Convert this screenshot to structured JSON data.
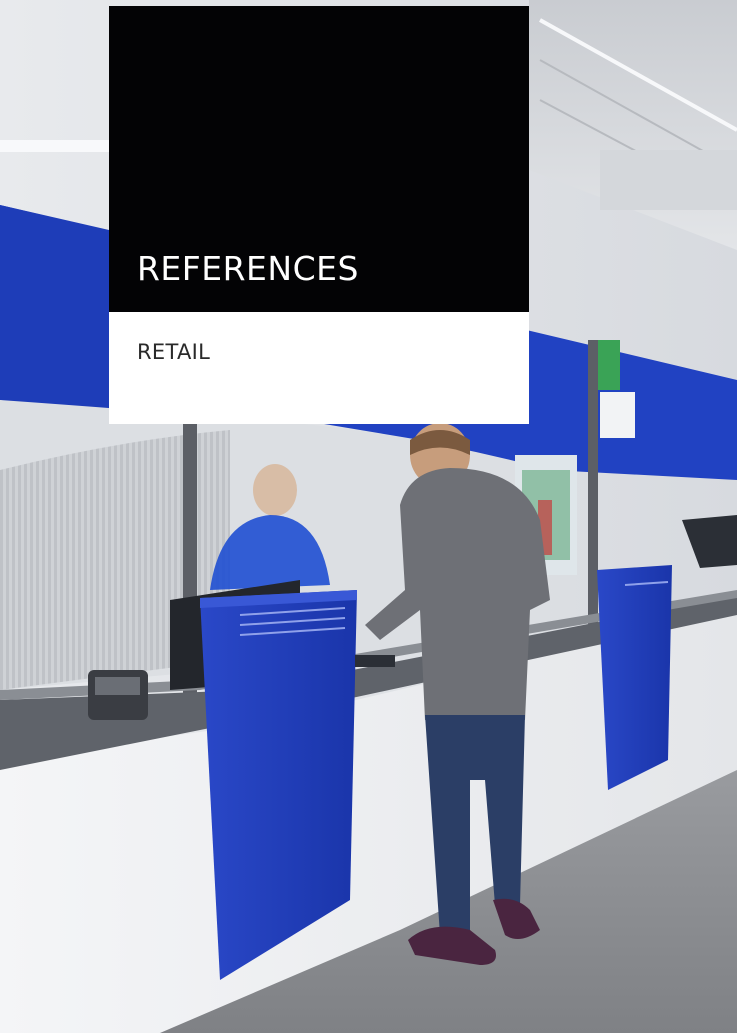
{
  "card": {
    "title": "REFERENCES",
    "subtitle": "RETAIL"
  },
  "photo": {
    "subject": "retail-service-counter",
    "colors": {
      "brand_blue": "#1f3fc0",
      "counter_white": "#f2f3f5",
      "floor_grey": "#8d8f93",
      "card_black": "#030305"
    }
  }
}
